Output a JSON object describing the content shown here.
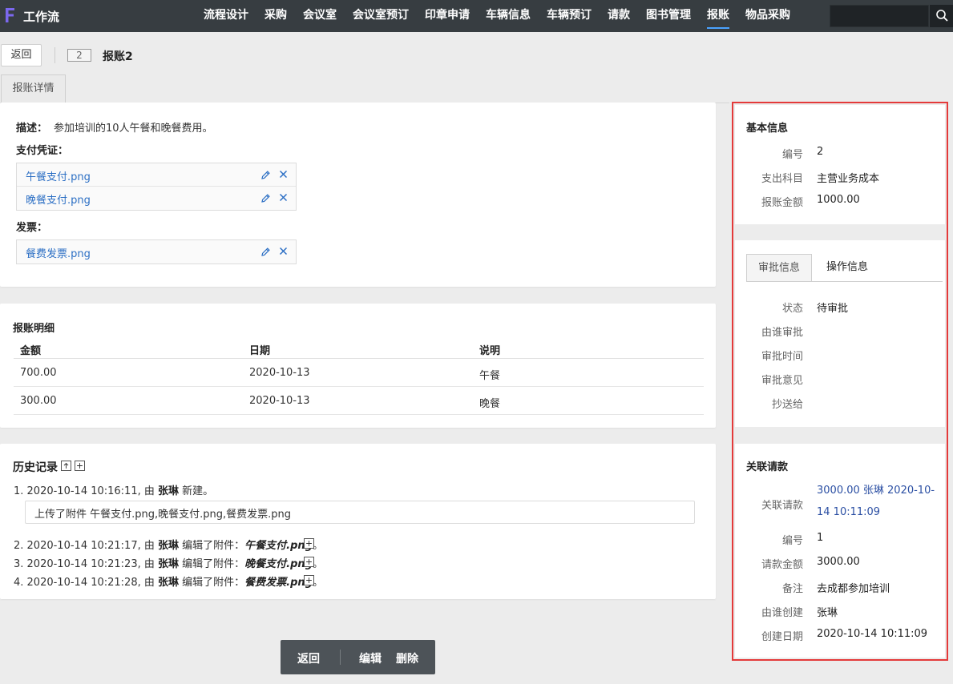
{
  "app": {
    "logo_letter": "F",
    "name": "工作流"
  },
  "nav": {
    "items": [
      "流程设计",
      "采购",
      "会议室",
      "会议室预订",
      "印章申请",
      "车辆信息",
      "车辆预订",
      "请款",
      "图书管理",
      "报账",
      "物品采购"
    ],
    "active_index": 9
  },
  "header": {
    "back_label": "返回",
    "id_badge": "2",
    "title": "报账2",
    "tab_label": "报账详情"
  },
  "detail": {
    "desc_label": "描述：",
    "desc_value": "参加培训的10人午餐和晚餐费用。",
    "voucher_label": "支付凭证：",
    "vouchers": [
      "午餐支付.png",
      "晚餐支付.png"
    ],
    "invoice_label": "发票：",
    "invoices": [
      "餐费发票.png"
    ]
  },
  "breakdown": {
    "title": "报账明细",
    "columns": [
      "金额",
      "日期",
      "说明"
    ],
    "rows": [
      [
        "700.00",
        "2020-10-13",
        "午餐"
      ],
      [
        "300.00",
        "2020-10-13",
        "晚餐"
      ]
    ]
  },
  "history": {
    "title": "历史记录",
    "entries": [
      {
        "prefix": "1. 2020-10-14 10:16:11, 由 ",
        "user": "张琳",
        "action": " 新建。",
        "file": "",
        "suffix": ""
      },
      {
        "prefix": "2. 2020-10-14 10:21:17, 由 ",
        "user": "张琳",
        "action": " 编辑了附件：",
        "file": "午餐支付.png",
        "suffix": "。"
      },
      {
        "prefix": "3. 2020-10-14 10:21:23, 由 ",
        "user": "张琳",
        "action": " 编辑了附件：",
        "file": "晚餐支付.png",
        "suffix": "。"
      },
      {
        "prefix": "4. 2020-10-14 10:21:28, 由 ",
        "user": "张琳",
        "action": " 编辑了附件：",
        "file": "餐费发票.png",
        "suffix": "。"
      }
    ],
    "note": "上传了附件 午餐支付.png,晚餐支付.png,餐费发票.png"
  },
  "actions": {
    "back": "返回",
    "edit": "编辑",
    "delete": "删除"
  },
  "basic_info": {
    "title": "基本信息",
    "fields": [
      {
        "label": "编号",
        "value": "2"
      },
      {
        "label": "支出科目",
        "value": "主营业务成本"
      },
      {
        "label": "报账金额",
        "value": "1000.00"
      }
    ]
  },
  "approval": {
    "tabs": [
      "审批信息",
      "操作信息"
    ],
    "fields": [
      {
        "label": "状态",
        "value": "待审批"
      },
      {
        "label": "由谁审批",
        "value": ""
      },
      {
        "label": "审批时间",
        "value": ""
      },
      {
        "label": "审批意见",
        "value": ""
      },
      {
        "label": "抄送给",
        "value": ""
      }
    ]
  },
  "related": {
    "title": "关联请款",
    "link_label": "关联请款",
    "link_value": "3000.00 张琳 2020-10-14 10:11:09",
    "fields": [
      {
        "label": "编号",
        "value": "1"
      },
      {
        "label": "请款金额",
        "value": "3000.00"
      },
      {
        "label": "备注",
        "value": "去成都参加培训"
      },
      {
        "label": "由谁创建",
        "value": "张琳"
      },
      {
        "label": "创建日期",
        "value": "2020-10-14 10:11:09"
      }
    ]
  },
  "colors": {
    "topbar": "#373d41",
    "link": "#2c6fc4",
    "highlight_border": "#e43a3a",
    "logo": "#7b68ee"
  },
  "icons": {
    "search": "search-icon",
    "edit": "pencil-icon",
    "delete": "close-icon",
    "collapse": "collapse-icon",
    "expand": "expand-icon"
  }
}
